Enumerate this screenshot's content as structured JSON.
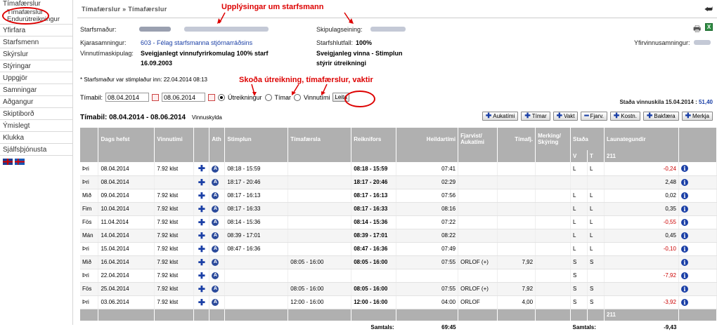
{
  "sidebar": {
    "items": [
      "Tímafærslur",
      "Tímafærslur",
      "Endurútreikningur",
      "Yfirfara",
      "Starfsmenn",
      "Skýrslur",
      "Stýringar",
      "Uppgjör",
      "Samningar",
      "Aðgangur",
      "Skiptiborð",
      "Ýmislegt",
      "Klukka",
      "Sjálfsþjónusta"
    ]
  },
  "header": {
    "breadcrumb": "Tímafærslur » Tímafærslur"
  },
  "annotations": {
    "a1": "Upplýsingar um starfsmann",
    "a2": "Skoða útreikning, tímafærslur, vaktir"
  },
  "info": {
    "starfsmadur_label": "Starfsmaður:",
    "skipulagseining_label": "Skipulagseining:",
    "kjarasamningur_label": "Kjarasamningur:",
    "kjarasamningur_value": "603 - Félag starfsmanna stjórnarráðsins",
    "starfshlutfall_label": "Starfshlutfall:",
    "starfshlutfall_value": "100%",
    "yfirvinnusamningur_label": "Yfirvinnusamningur:",
    "vinnutimaskipulag_label": "Vinnutímaskipulag:",
    "vinnutimaskipulag_value1": "Sveigjanlegt vinnufyrirkomulag 100% starf",
    "vinnutimaskipulag_value2": "16.09.2003",
    "sveigjanleg1": "Sveigjanleg vinna - Stimplun",
    "sveigjanleg2": "stýrir útreikningi",
    "stimplun_note": "* Starfsmaður var stimplaður inn: 22.04.2014 08:13"
  },
  "filter": {
    "label": "Tímabil:",
    "from": "08.04.2014",
    "to": "08.06.2014",
    "opt1": "Útreikningur",
    "opt2": "Tímar",
    "opt3": "Vinnutími",
    "search": "Leita",
    "stada": "Staða vinnuskila 15.04.2014 :",
    "stada_val": "51,40"
  },
  "period": {
    "title": "Tímabil: 08.04.2014 - 08.06.2014",
    "sub": "Vinnuskylda"
  },
  "buttons": [
    "Aukatími",
    "Tímar",
    "Vakt",
    "Fjarv.",
    "Kostn.",
    "Bakfæra",
    "Merkja"
  ],
  "table": {
    "headers": [
      "Dags hefst",
      "Vinnutími",
      "Ath",
      "Stimplun",
      "Tímafærsla",
      "Reiknifors",
      "Heildartími",
      "Fjarvist/ Aukatími",
      "Tímafj.",
      "Merking/ Skýring",
      "Staða",
      "Launategundir"
    ],
    "sub_v": "V",
    "sub_t": "T",
    "sub_code": "211",
    "rows": [
      {
        "day": "Þri",
        "date": "08.04.2014",
        "vinnu": "7.92 klst",
        "stimp": "08:18 - 15:59",
        "timaf": "",
        "reikn": "08:18 - 15:59",
        "heild": "07:41",
        "fjar": "",
        "tfj": "",
        "v": "L",
        "t": "L",
        "laun": "-0,24",
        "neg": true
      },
      {
        "day": "Þri",
        "date": "08.04.2014",
        "vinnu": "",
        "stimp": "18:17 - 20:46",
        "timaf": "",
        "reikn": "18:17 - 20:46",
        "heild": "02:29",
        "fjar": "",
        "tfj": "",
        "v": "",
        "t": "",
        "laun": "2,48",
        "neg": false
      },
      {
        "day": "Mið",
        "date": "09.04.2014",
        "vinnu": "7.92 klst",
        "stimp": "08:17 - 16:13",
        "timaf": "",
        "reikn": "08:17 - 16:13",
        "heild": "07:56",
        "fjar": "",
        "tfj": "",
        "v": "L",
        "t": "L",
        "laun": "0,02",
        "neg": false
      },
      {
        "day": "Fim",
        "date": "10.04.2014",
        "vinnu": "7.92 klst",
        "stimp": "08:17 - 16:33",
        "timaf": "",
        "reikn": "08:17 - 16:33",
        "heild": "08:16",
        "fjar": "",
        "tfj": "",
        "v": "L",
        "t": "L",
        "laun": "0,35",
        "neg": false
      },
      {
        "day": "Fös",
        "date": "11.04.2014",
        "vinnu": "7.92 klst",
        "stimp": "08:14 - 15:36",
        "timaf": "",
        "reikn": "08:14 - 15:36",
        "heild": "07:22",
        "fjar": "",
        "tfj": "",
        "v": "L",
        "t": "L",
        "laun": "-0,55",
        "neg": true
      },
      {
        "day": "Mán",
        "date": "14.04.2014",
        "vinnu": "7.92 klst",
        "stimp": "08:39 - 17:01",
        "timaf": "",
        "reikn": "08:39 - 17:01",
        "heild": "08:22",
        "fjar": "",
        "tfj": "",
        "v": "L",
        "t": "L",
        "laun": "0,45",
        "neg": false
      },
      {
        "day": "Þri",
        "date": "15.04.2014",
        "vinnu": "7.92 klst",
        "stimp": "08:47 - 16:36",
        "timaf": "",
        "reikn": "08:47 - 16:36",
        "heild": "07:49",
        "fjar": "",
        "tfj": "",
        "v": "L",
        "t": "L",
        "laun": "-0,10",
        "neg": true
      },
      {
        "day": "Mið",
        "date": "16.04.2014",
        "vinnu": "7.92 klst",
        "stimp": "",
        "timaf": "08:05 - 16:00",
        "reikn": "08:05 - 16:00",
        "heild": "07:55",
        "fjar": "ORLOF (+)",
        "tfj": "7,92",
        "v": "S",
        "t": "S",
        "laun": "",
        "neg": false
      },
      {
        "day": "Þri",
        "date": "22.04.2014",
        "vinnu": "7.92 klst",
        "stimp": "",
        "timaf": "",
        "reikn": "",
        "heild": "",
        "fjar": "",
        "tfj": "",
        "v": "S",
        "t": "",
        "laun": "-7,92",
        "neg": true
      },
      {
        "day": "Fös",
        "date": "25.04.2014",
        "vinnu": "7.92 klst",
        "stimp": "",
        "timaf": "08:05 - 16:00",
        "reikn": "08:05 - 16:00",
        "heild": "07:55",
        "fjar": "ORLOF (+)",
        "tfj": "7,92",
        "v": "S",
        "t": "S",
        "laun": "",
        "neg": false
      },
      {
        "day": "Þri",
        "date": "03.06.2014",
        "vinnu": "7.92 klst",
        "stimp": "",
        "timaf": "12:00 - 16:00",
        "reikn": "12:00 - 16:00",
        "heild": "04:00",
        "fjar": "ORLOF",
        "tfj": "4,00",
        "v": "S",
        "t": "S",
        "laun": "-3,92",
        "neg": true
      }
    ],
    "footer_code": "211",
    "samtals_label": "Samtals:",
    "samtals_heild": "69:45",
    "samtals_label2": "Samtals:",
    "samtals_laun": "-9,43"
  }
}
